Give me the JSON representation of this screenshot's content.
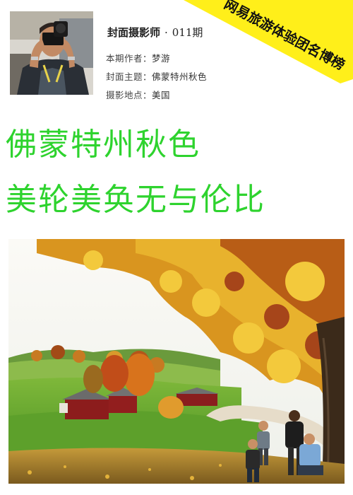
{
  "header": {
    "column_title": "封面摄影师",
    "separator": "·",
    "issue_no": "011期",
    "banner": "网易旅游体验团名博榜",
    "rows": [
      {
        "label": "本期作者：",
        "value": "梦游"
      },
      {
        "label": "封面主题：",
        "value": "佛蒙特州秋色"
      },
      {
        "label": "摄影地点：",
        "value": "美国"
      }
    ]
  },
  "headline": {
    "line1": "佛蒙特州秋色",
    "line2": "美轮美奂无与伦比"
  },
  "colors": {
    "headline": "#2ed32e",
    "banner": "#ffef1a"
  }
}
